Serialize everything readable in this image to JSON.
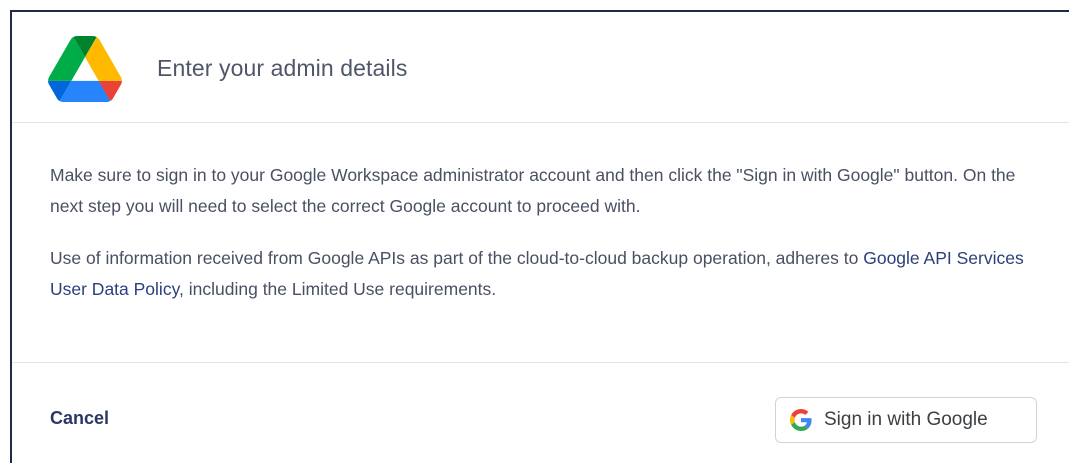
{
  "dialog": {
    "title": "Enter your admin details",
    "paragraph1": "Make sure to sign in to your Google Workspace administrator account and then click the \"Sign in with Google\" button. On the next step you will need to select the correct Google account to proceed with.",
    "paragraph2_before": "Use of information received from Google APIs as part of the cloud-to-cloud backup operation, adheres to ",
    "paragraph2_link": "Google API Services User Data Policy",
    "paragraph2_after": ", including the Limited Use requirements.",
    "cancel_label": "Cancel",
    "google_button_label": "Sign in with Google"
  },
  "icons": {
    "logo": "google-drive-icon",
    "google": "google-g-icon"
  },
  "colors": {
    "text": "#4a5064",
    "link": "#2c3f7a",
    "cancel": "#2c3766",
    "border": "#e3e5ea"
  }
}
